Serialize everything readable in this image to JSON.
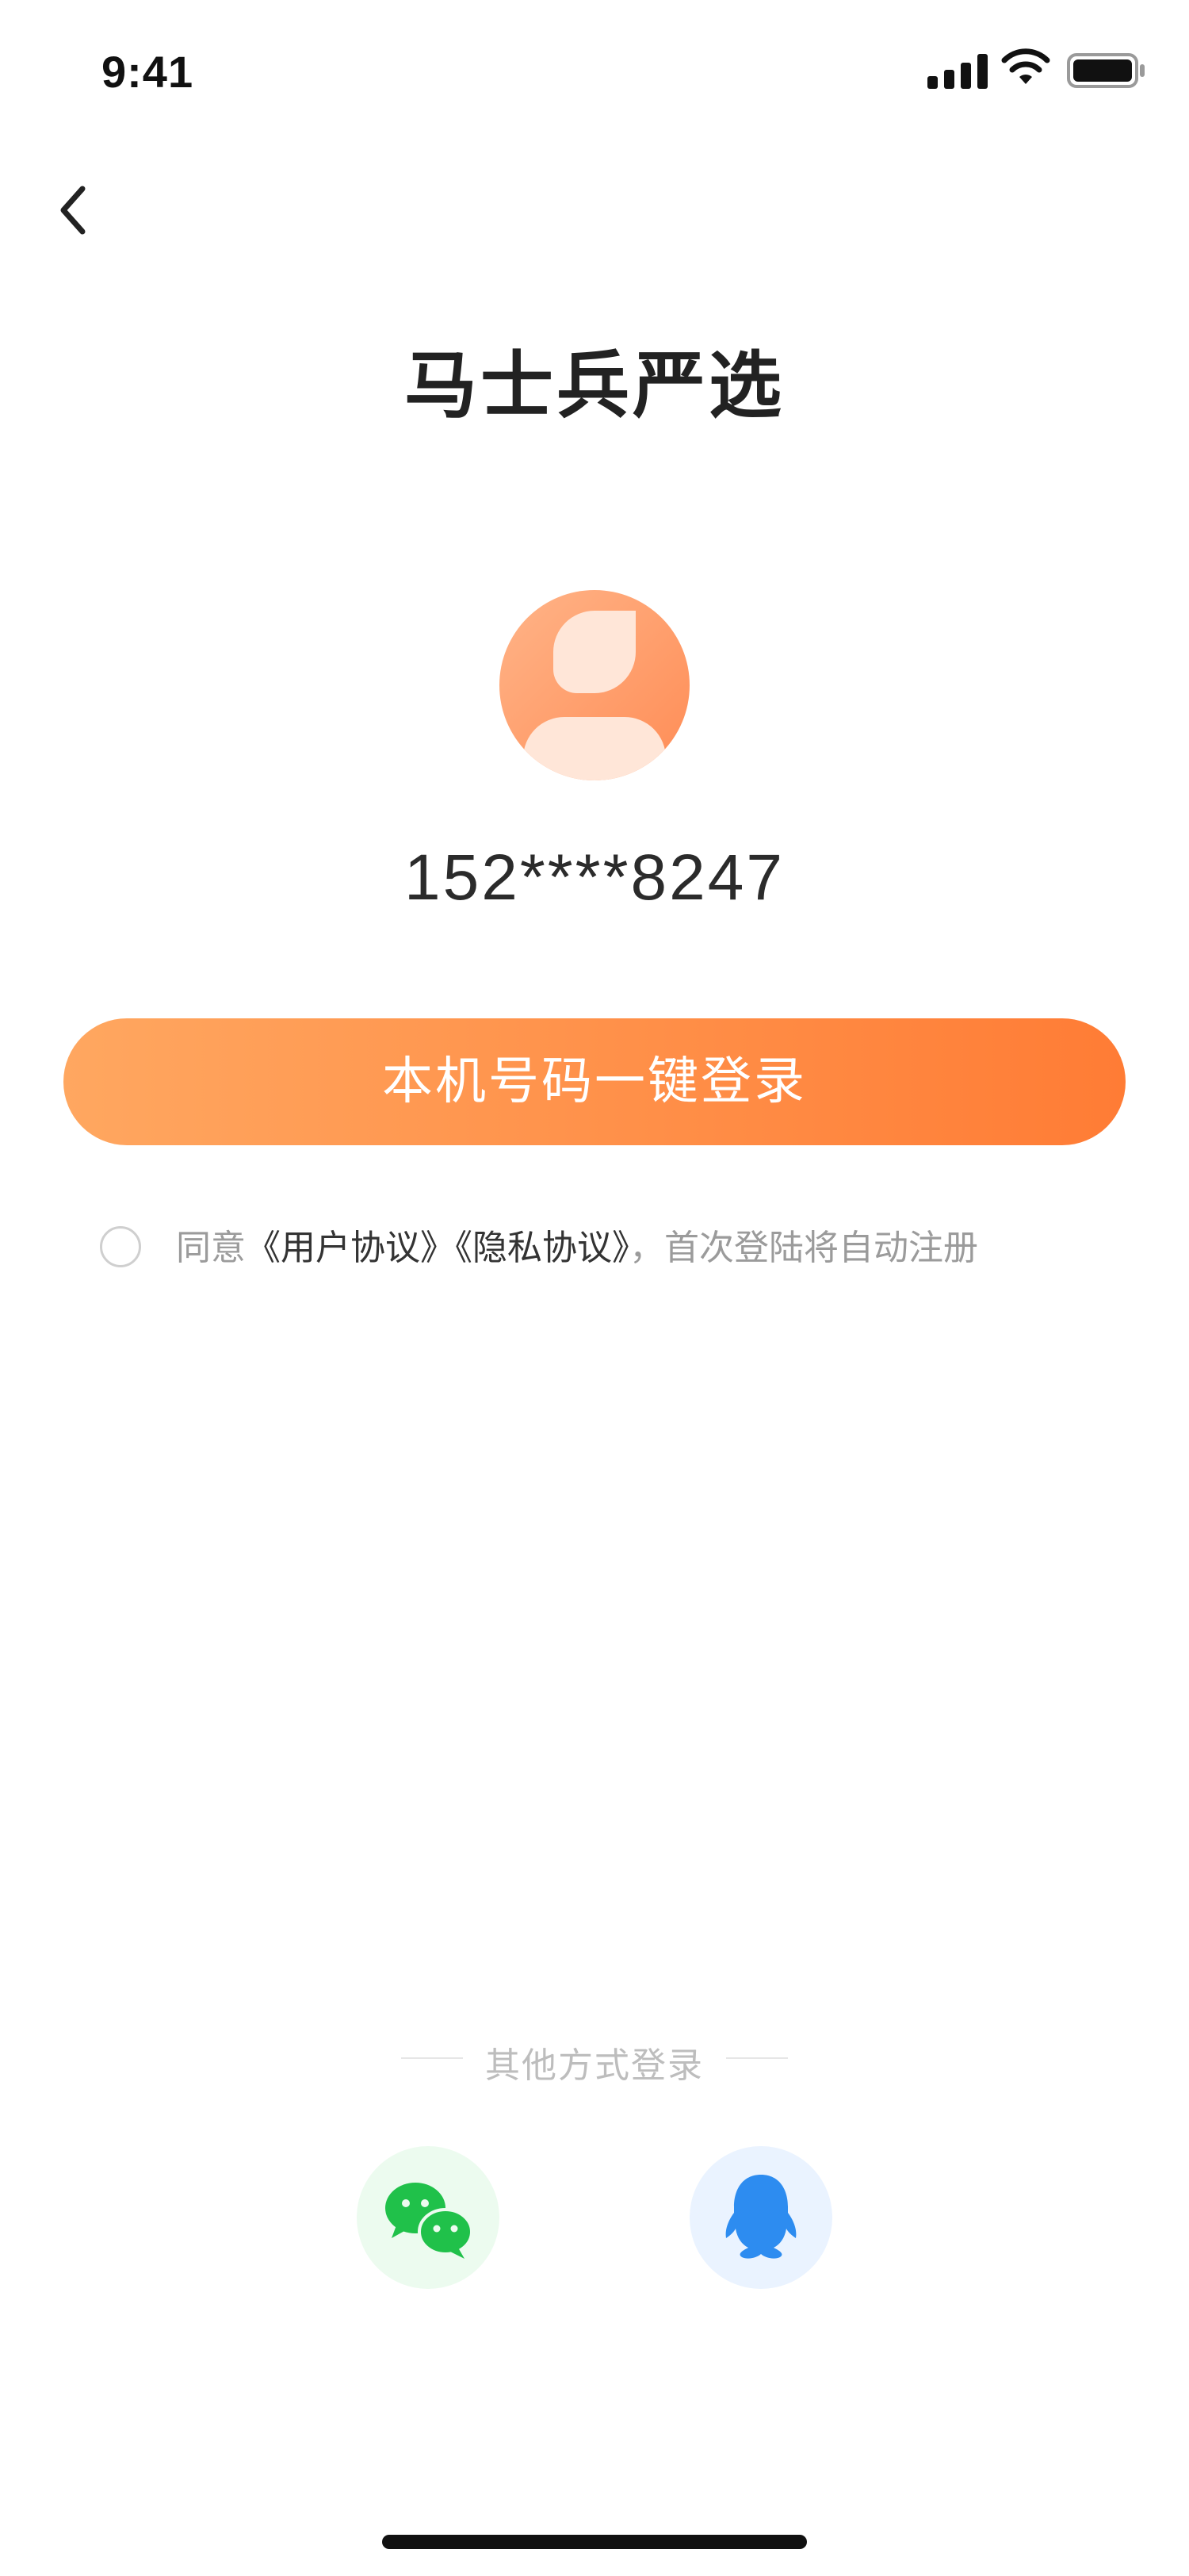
{
  "status_bar": {
    "time": "9:41"
  },
  "nav": {
    "back_icon": "chevron-left-icon"
  },
  "header": {
    "title": "马士兵严选"
  },
  "account": {
    "avatar_icon": "user-avatar-icon",
    "phone": "152****8247"
  },
  "actions": {
    "login_label": "本机号码一键登录"
  },
  "agreement": {
    "prefix": "同意",
    "user_agreement": "《用户协议》",
    "privacy_agreement": "《隐私协议》",
    "suffix": "，首次登陆将自动注册",
    "checked": false
  },
  "other_login": {
    "label": "其他方式登录",
    "methods": [
      {
        "name": "wechat",
        "icon": "wechat-icon",
        "color": "#20c14a"
      },
      {
        "name": "qq",
        "icon": "qq-penguin-icon",
        "color": "#2d8cf0"
      }
    ]
  },
  "colors": {
    "accent_start": "#ffa760",
    "accent_end": "#ff7c35"
  }
}
